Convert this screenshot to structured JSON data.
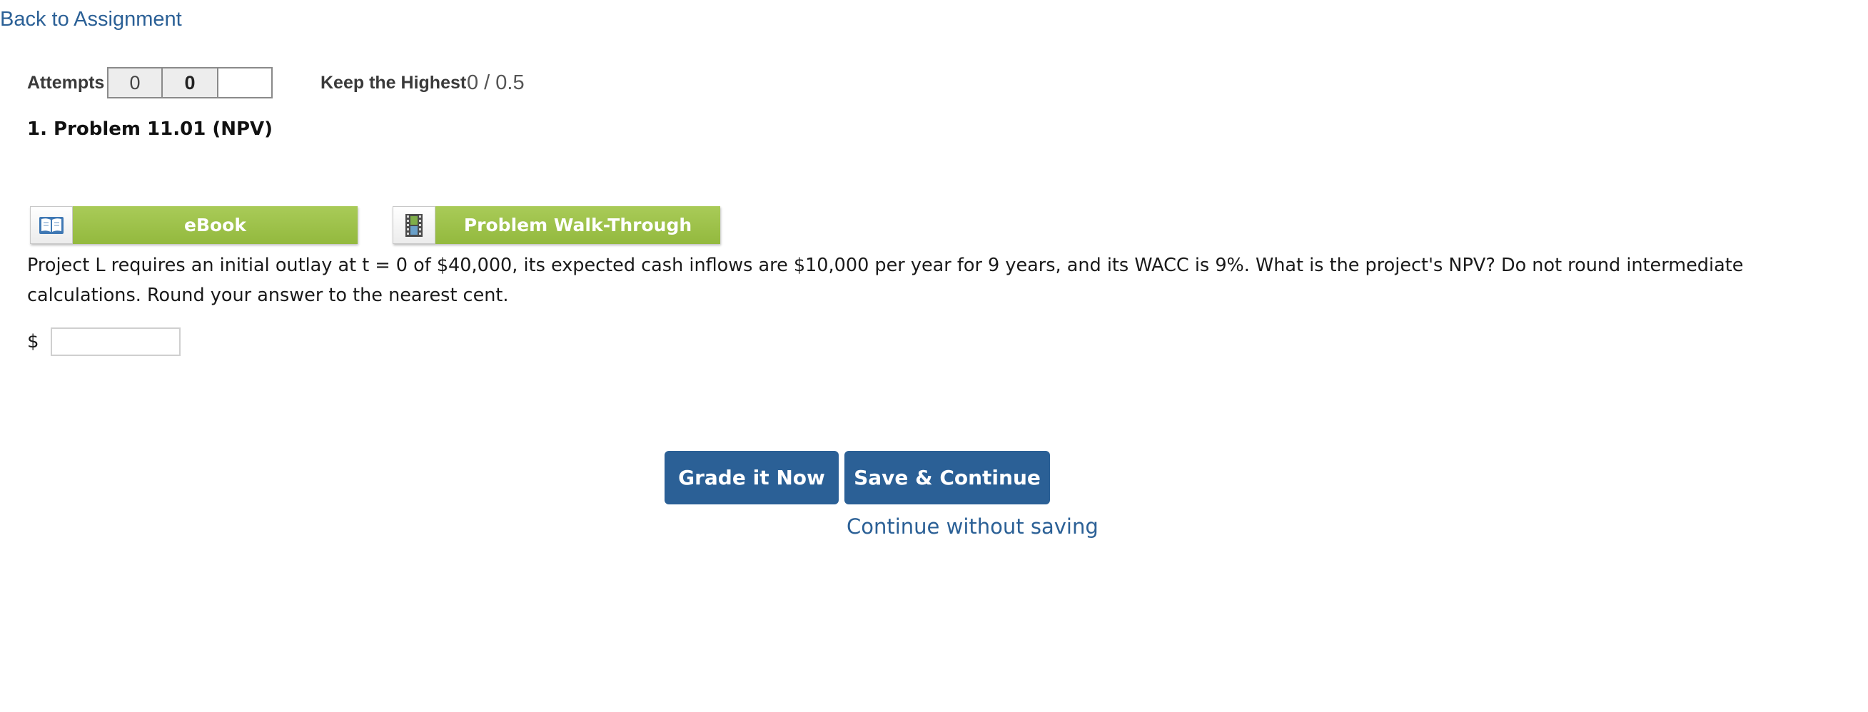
{
  "nav": {
    "back_link": "Back to Assignment"
  },
  "attempts": {
    "label": "Attempts",
    "boxes": [
      "0",
      "0",
      ""
    ]
  },
  "grading": {
    "policy_label": "Keep the Highest",
    "score": "0 / 0.5"
  },
  "problem": {
    "title": "1.  Problem 11.01 (NPV)",
    "question": "Project L requires an initial outlay at t = 0 of $40,000, its expected cash inflows are $10,000 per year for 9 years, and its WACC is 9%. What is the project's NPV? Do not round intermediate calculations. Round your answer to the nearest cent.",
    "currency_symbol": "$",
    "answer_value": ""
  },
  "resources": [
    {
      "label": "eBook",
      "icon": "book-icon"
    },
    {
      "label": "Problem Walk-Through",
      "icon": "film-icon"
    }
  ],
  "actions": {
    "grade_label": "Grade it Now",
    "save_label": "Save & Continue",
    "continue_label": "Continue without saving"
  },
  "colors": {
    "link": "#2b6096",
    "primary_button": "#2b6096",
    "resource_green": "#9ec24b"
  }
}
